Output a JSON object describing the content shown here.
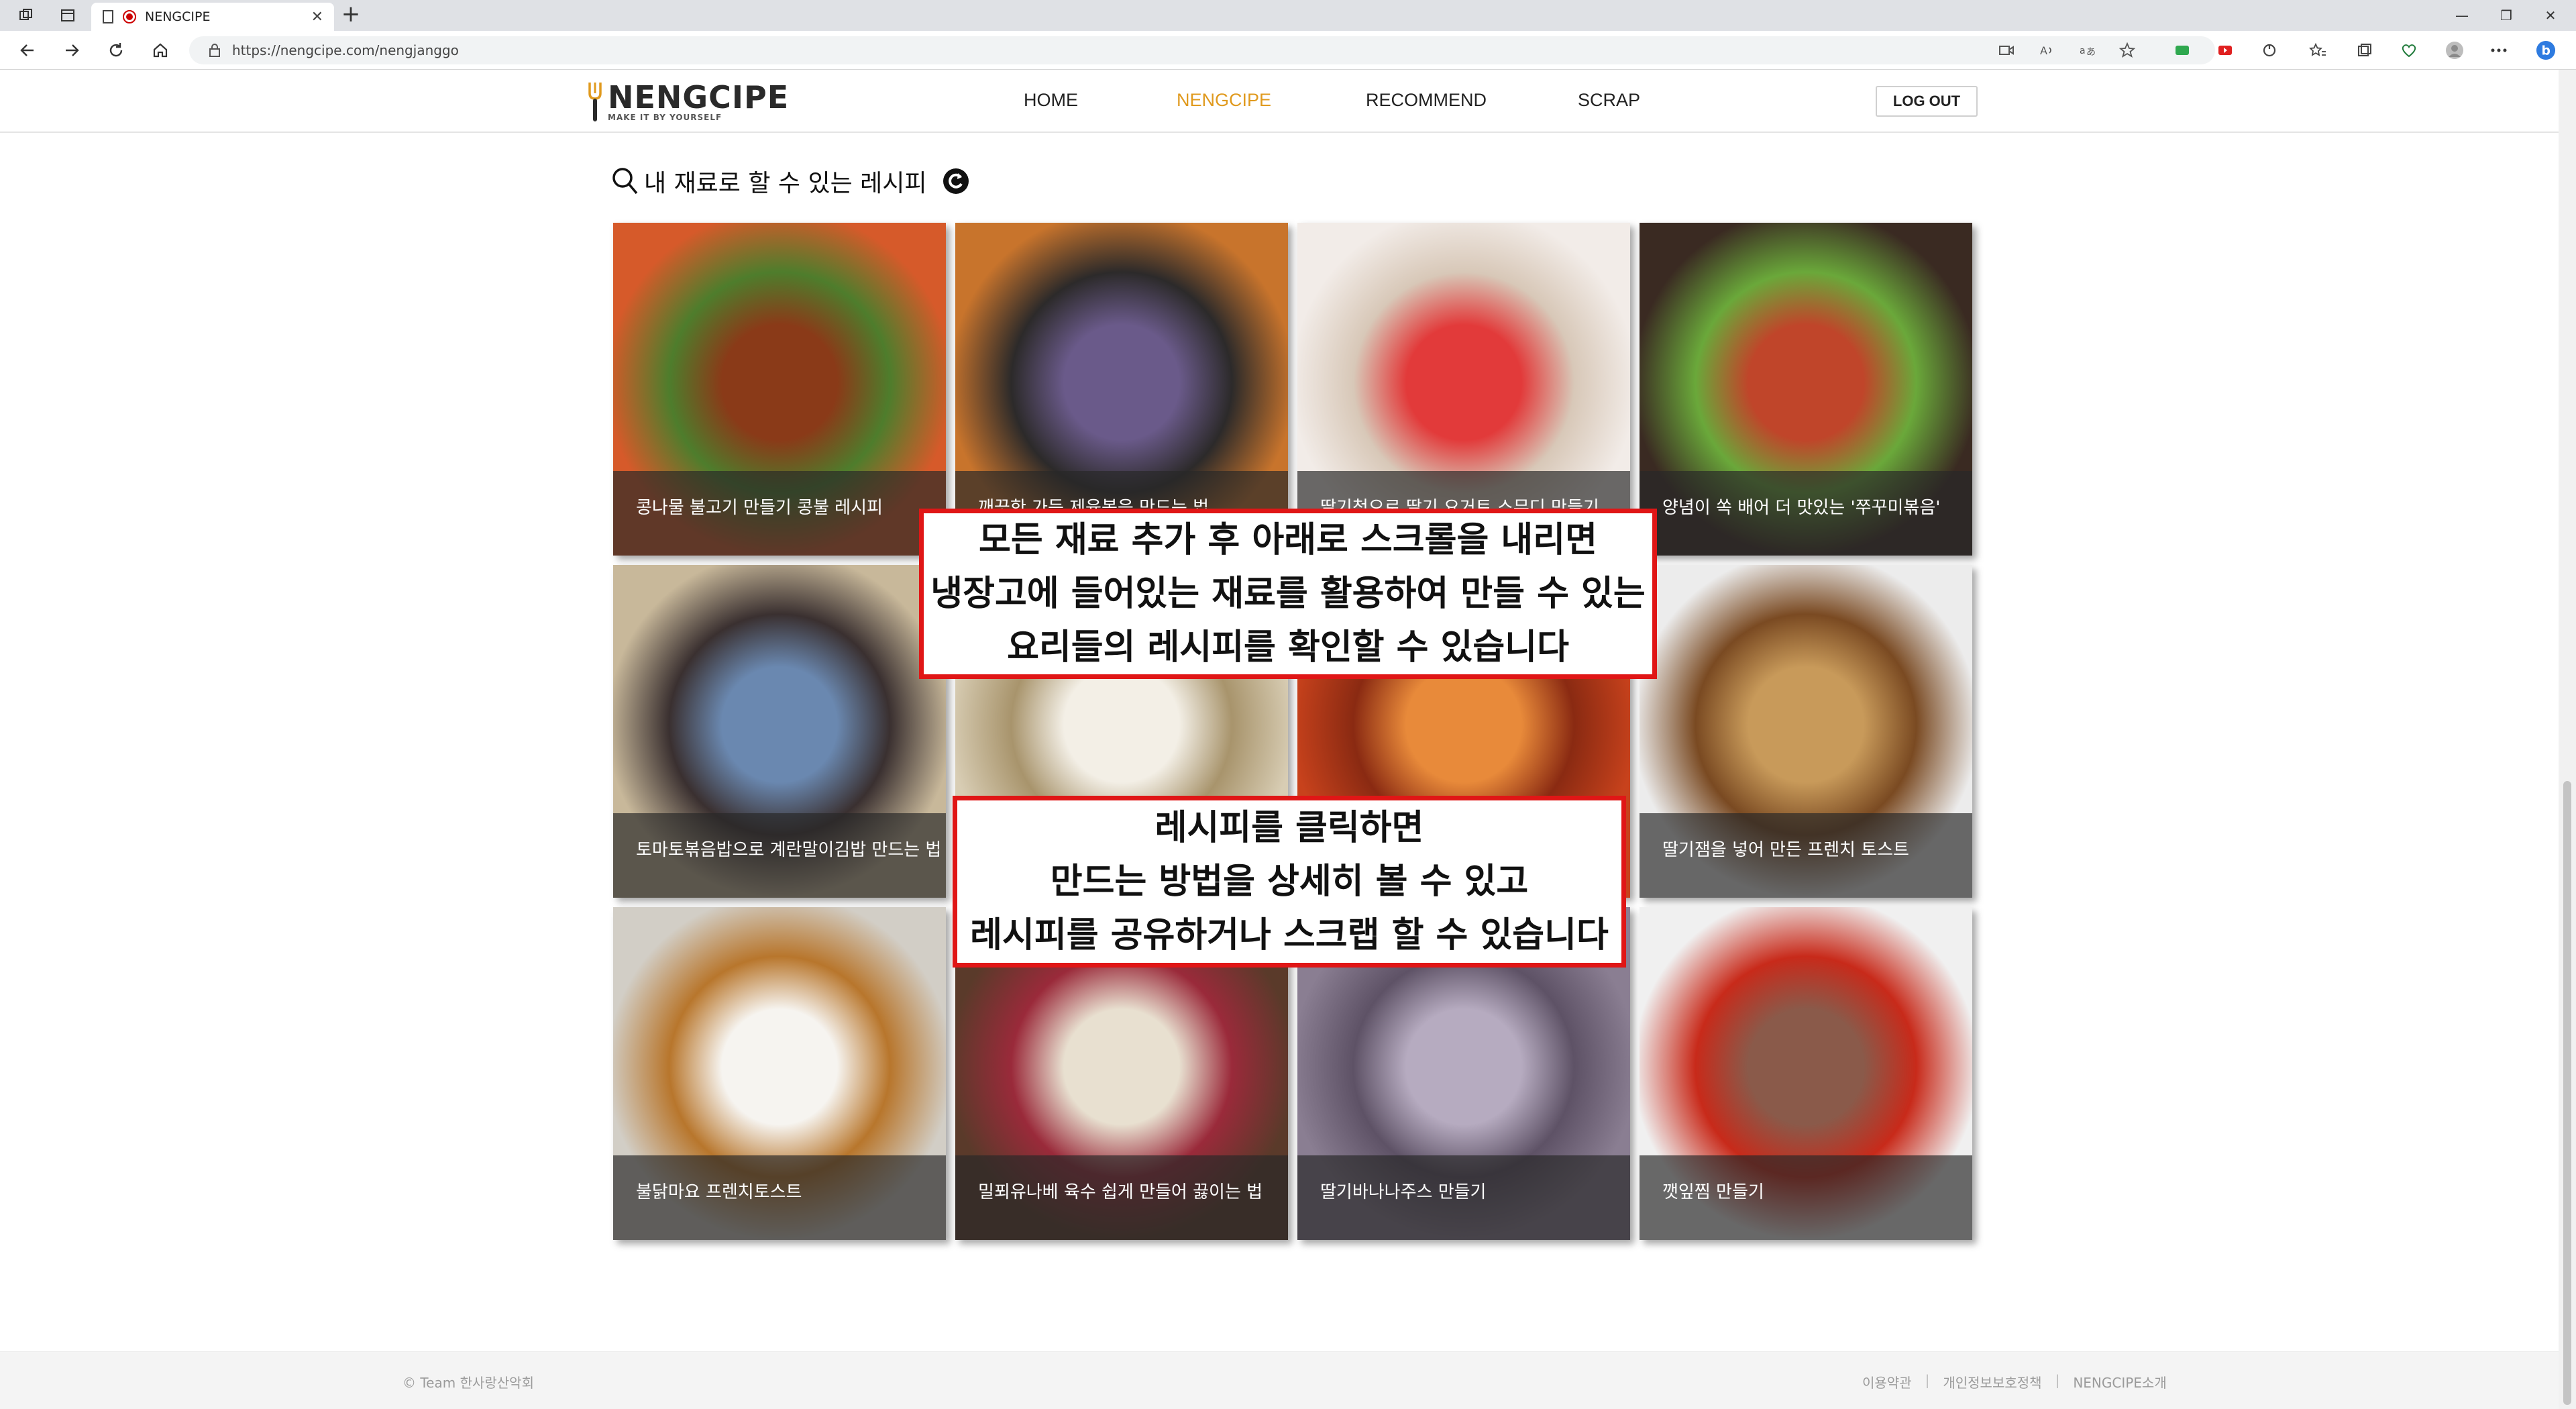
{
  "browser": {
    "tab_title": "NENGCIPE",
    "url": "https://nengcipe.com/nengjanggo"
  },
  "site": {
    "logo_main": "NENGCIPE",
    "logo_sub": "MAKE IT BY YOURSELF",
    "nav": [
      {
        "label": "HOME",
        "active": false
      },
      {
        "label": "NENGCIPE",
        "active": true
      },
      {
        "label": "RECOMMEND",
        "active": false
      },
      {
        "label": "SCRAP",
        "active": false
      }
    ],
    "logout_label": "LOG OUT",
    "accent_color": "#e09a1e"
  },
  "section": {
    "title": "내 재료로 할 수 있는 레시피"
  },
  "recipes": [
    {
      "caption": "콩나물 불고기 만들기 콩불 레시피",
      "palette": [
        "#d65a2a",
        "#8a3a18",
        "#4e7d2c"
      ]
    },
    {
      "caption": "깨끗한 가든 제육볶음 만드는 법",
      "palette": [
        "#c8742c",
        "#6a5a8a",
        "#2c2a2a"
      ]
    },
    {
      "caption": "딸기청으로 딸기 요거트 스무디 만들기",
      "palette": [
        "#f2ece8",
        "#e23a3a",
        "#d8c8b8"
      ]
    },
    {
      "caption": "양념이 쏙 배어 더 맛있는 '쭈꾸미볶음'",
      "palette": [
        "#3a2a22",
        "#c0452a",
        "#6aa83a"
      ]
    },
    {
      "caption": "토마토볶음밥으로 계란말이김밥 만드는 법",
      "palette": [
        "#c8b89a",
        "#6a88b0",
        "#3a3030"
      ]
    },
    {
      "caption": "",
      "palette": [
        "#d8cdb4",
        "#f3efe6",
        "#a8946c"
      ]
    },
    {
      "caption": "",
      "palette": [
        "#c8421c",
        "#e88a3a",
        "#8a2a12"
      ]
    },
    {
      "caption": "딸기잼을 넣어 만든 프렌치 토스트",
      "palette": [
        "#ececec",
        "#c89a5a",
        "#7a4a22"
      ]
    },
    {
      "caption": "불닭마요 프렌치토스트",
      "palette": [
        "#d2cec6",
        "#f6f4f0",
        "#b8762c"
      ]
    },
    {
      "caption": "밀푀유나베 육수 쉽게 만들어 끓이는 법",
      "palette": [
        "#5a3a2a",
        "#e8e0d0",
        "#9a2a3a"
      ]
    },
    {
      "caption": "딸기바나나주스 만들기",
      "palette": [
        "#8a7e92",
        "#b6abc0",
        "#5e5266"
      ]
    },
    {
      "caption": "깻잎찜 만들기",
      "palette": [
        "#f0f0f0",
        "#8a5a4a",
        "#c82a1a"
      ]
    }
  ],
  "callouts": [
    {
      "lines": [
        "모든 재료 추가 후 아래로 스크롤을 내리면",
        "냉장고에 들어있는 재료를 활용하여 만들 수 있는",
        "요리들의 레시피를 확인할 수 있습니다"
      ]
    },
    {
      "lines": [
        "레시피를 클릭하면",
        "만드는 방법을 상세히 볼 수 있고",
        "레시피를 공유하거나 스크랩 할 수 있습니다"
      ]
    }
  ],
  "footer": {
    "copyright": "© Team 한사랑산악회",
    "links": [
      "이용약관",
      "개인정보보호정책",
      "NENGCIPE소개"
    ]
  }
}
